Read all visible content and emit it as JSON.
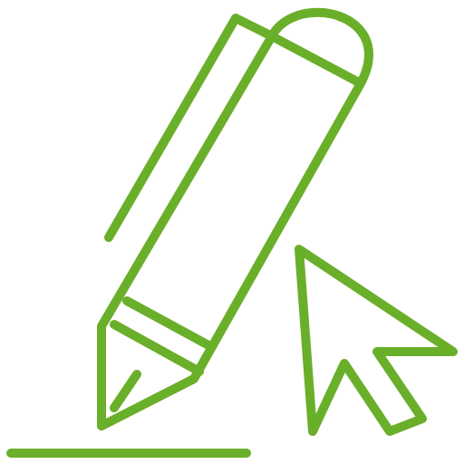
{
  "colors": {
    "primary": "#6aaf2a"
  },
  "icons": {
    "pen": "pen-icon",
    "cursor": "cursor-arrow-icon",
    "baseline": "baseline-icon"
  }
}
